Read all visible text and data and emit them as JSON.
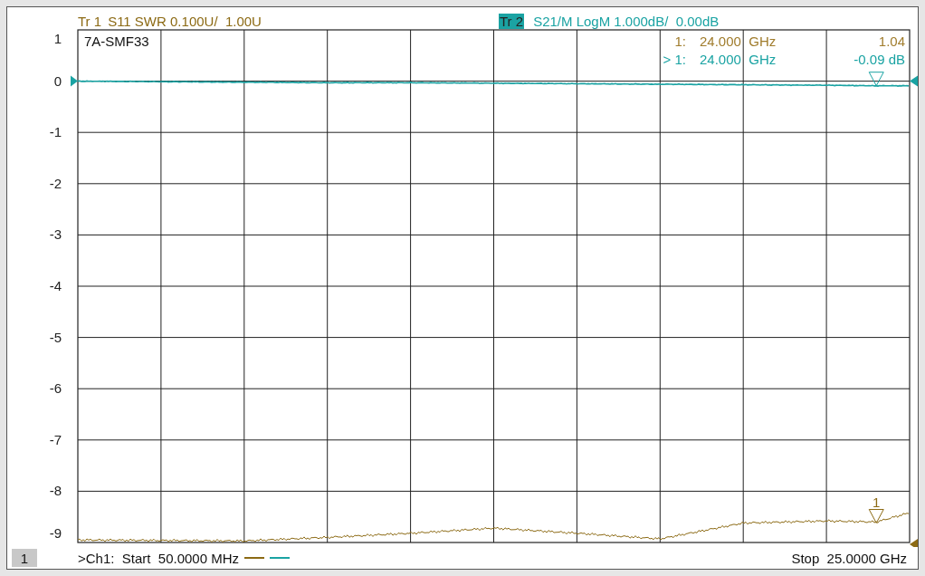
{
  "traces": [
    {
      "label": "Tr 1",
      "selected": false,
      "description": "S11 SWR 0.100U/  1.00U",
      "color": "#8c6a14"
    },
    {
      "label": "Tr 2",
      "selected": true,
      "description": "S21/M LogM 1.000dB/  0.00dB",
      "color": "#1aa3a3"
    }
  ],
  "chart": {
    "title": "7A-SMF33",
    "y_axis_labels": [
      "1",
      "0",
      "-1",
      "-2",
      "-3",
      "-4",
      "-5",
      "-6",
      "-7",
      "-8",
      "-9"
    ],
    "marker_readout": [
      {
        "index": "1:",
        "frequency": "24.000  GHz",
        "value": "1.04",
        "color": "#a07c2c"
      },
      {
        "index": "> 1:",
        "frequency": "24.000  GHz",
        "value": "-0.09 dB",
        "color": "#1aa3a3"
      }
    ],
    "trace_marker_label": "1"
  },
  "footer": {
    "channel": "1",
    "start": ">Ch1:  Start  50.0000 MHz",
    "stop": "Stop  25.0000 GHz"
  }
}
